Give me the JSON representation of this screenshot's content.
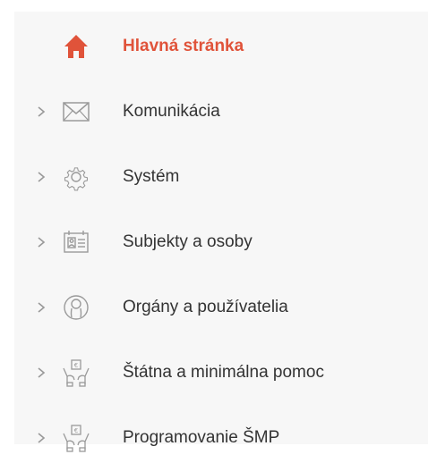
{
  "colors": {
    "accent": "#e0533a",
    "text": "#333333",
    "icon": "#9a9a9a",
    "panel_background": "#f7f7f7"
  },
  "sidebar": {
    "items": [
      {
        "label": "Hlavná stránka",
        "icon": "home-icon",
        "active": true
      },
      {
        "label": "Komunikácia",
        "icon": "envelope-icon",
        "active": false
      },
      {
        "label": "Systém",
        "icon": "gear-icon",
        "active": false
      },
      {
        "label": "Subjekty a osoby",
        "icon": "id-card-icon",
        "active": false
      },
      {
        "label": "Orgány a používatelia",
        "icon": "user-circle-icon",
        "active": false
      },
      {
        "label": "Štátna a minimálna pomoc",
        "icon": "assistance-icon",
        "active": false
      },
      {
        "label": "Programovanie ŠMP",
        "icon": "assistance-icon",
        "active": false
      }
    ]
  }
}
